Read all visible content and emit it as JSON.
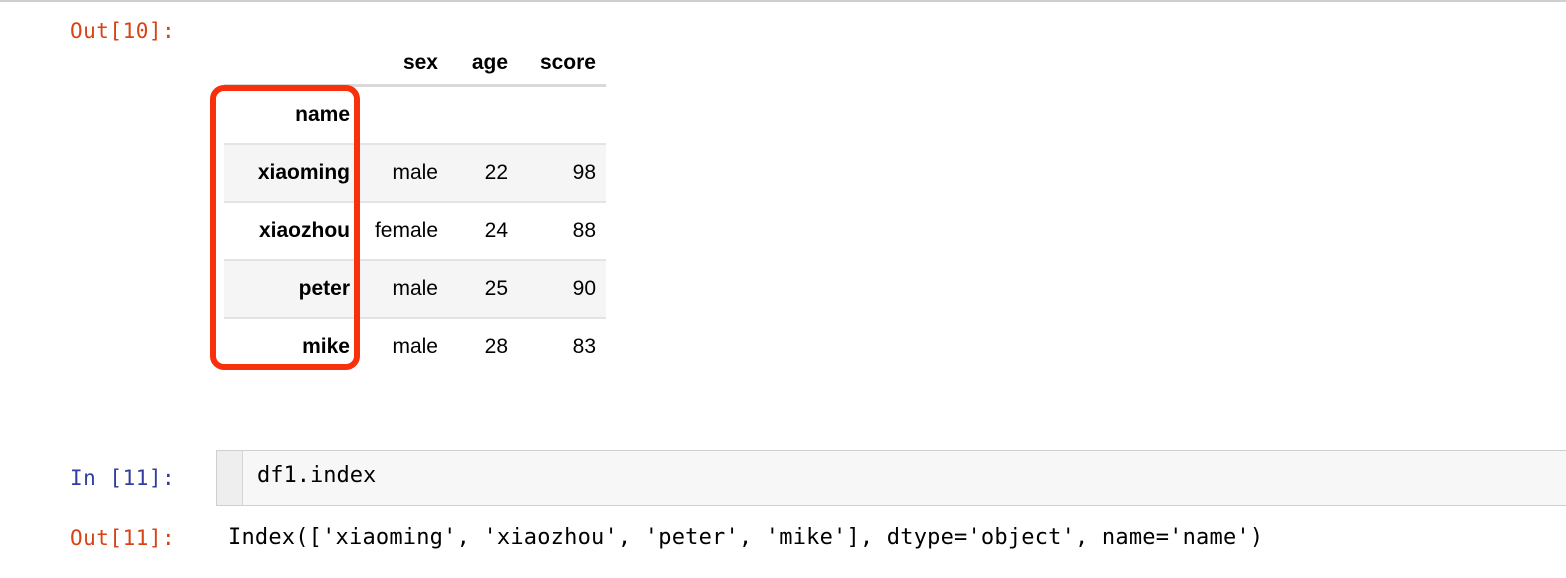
{
  "colors": {
    "out_prompt": "#d84315",
    "in_prompt": "#303f9f",
    "highlight": "#f8300c",
    "stripe": "#f5f5f5",
    "cell_bg": "#f7f7f7"
  },
  "cells": {
    "out10": {
      "prompt": "Out[10]:"
    },
    "in11": {
      "prompt": "In [11]:",
      "code": "df1.index"
    },
    "out11": {
      "prompt": "Out[11]:",
      "text": "Index(['xiaoming', 'xiaozhou', 'peter', 'mike'], dtype='object', name='name')"
    }
  },
  "dataframe": {
    "index_name": "name",
    "columns": [
      "sex",
      "age",
      "score"
    ],
    "rows": [
      {
        "index": "xiaoming",
        "sex": "male",
        "age": "22",
        "score": "98"
      },
      {
        "index": "xiaozhou",
        "sex": "female",
        "age": "24",
        "score": "88"
      },
      {
        "index": "peter",
        "sex": "male",
        "age": "25",
        "score": "90"
      },
      {
        "index": "mike",
        "sex": "male",
        "age": "28",
        "score": "83"
      }
    ]
  }
}
